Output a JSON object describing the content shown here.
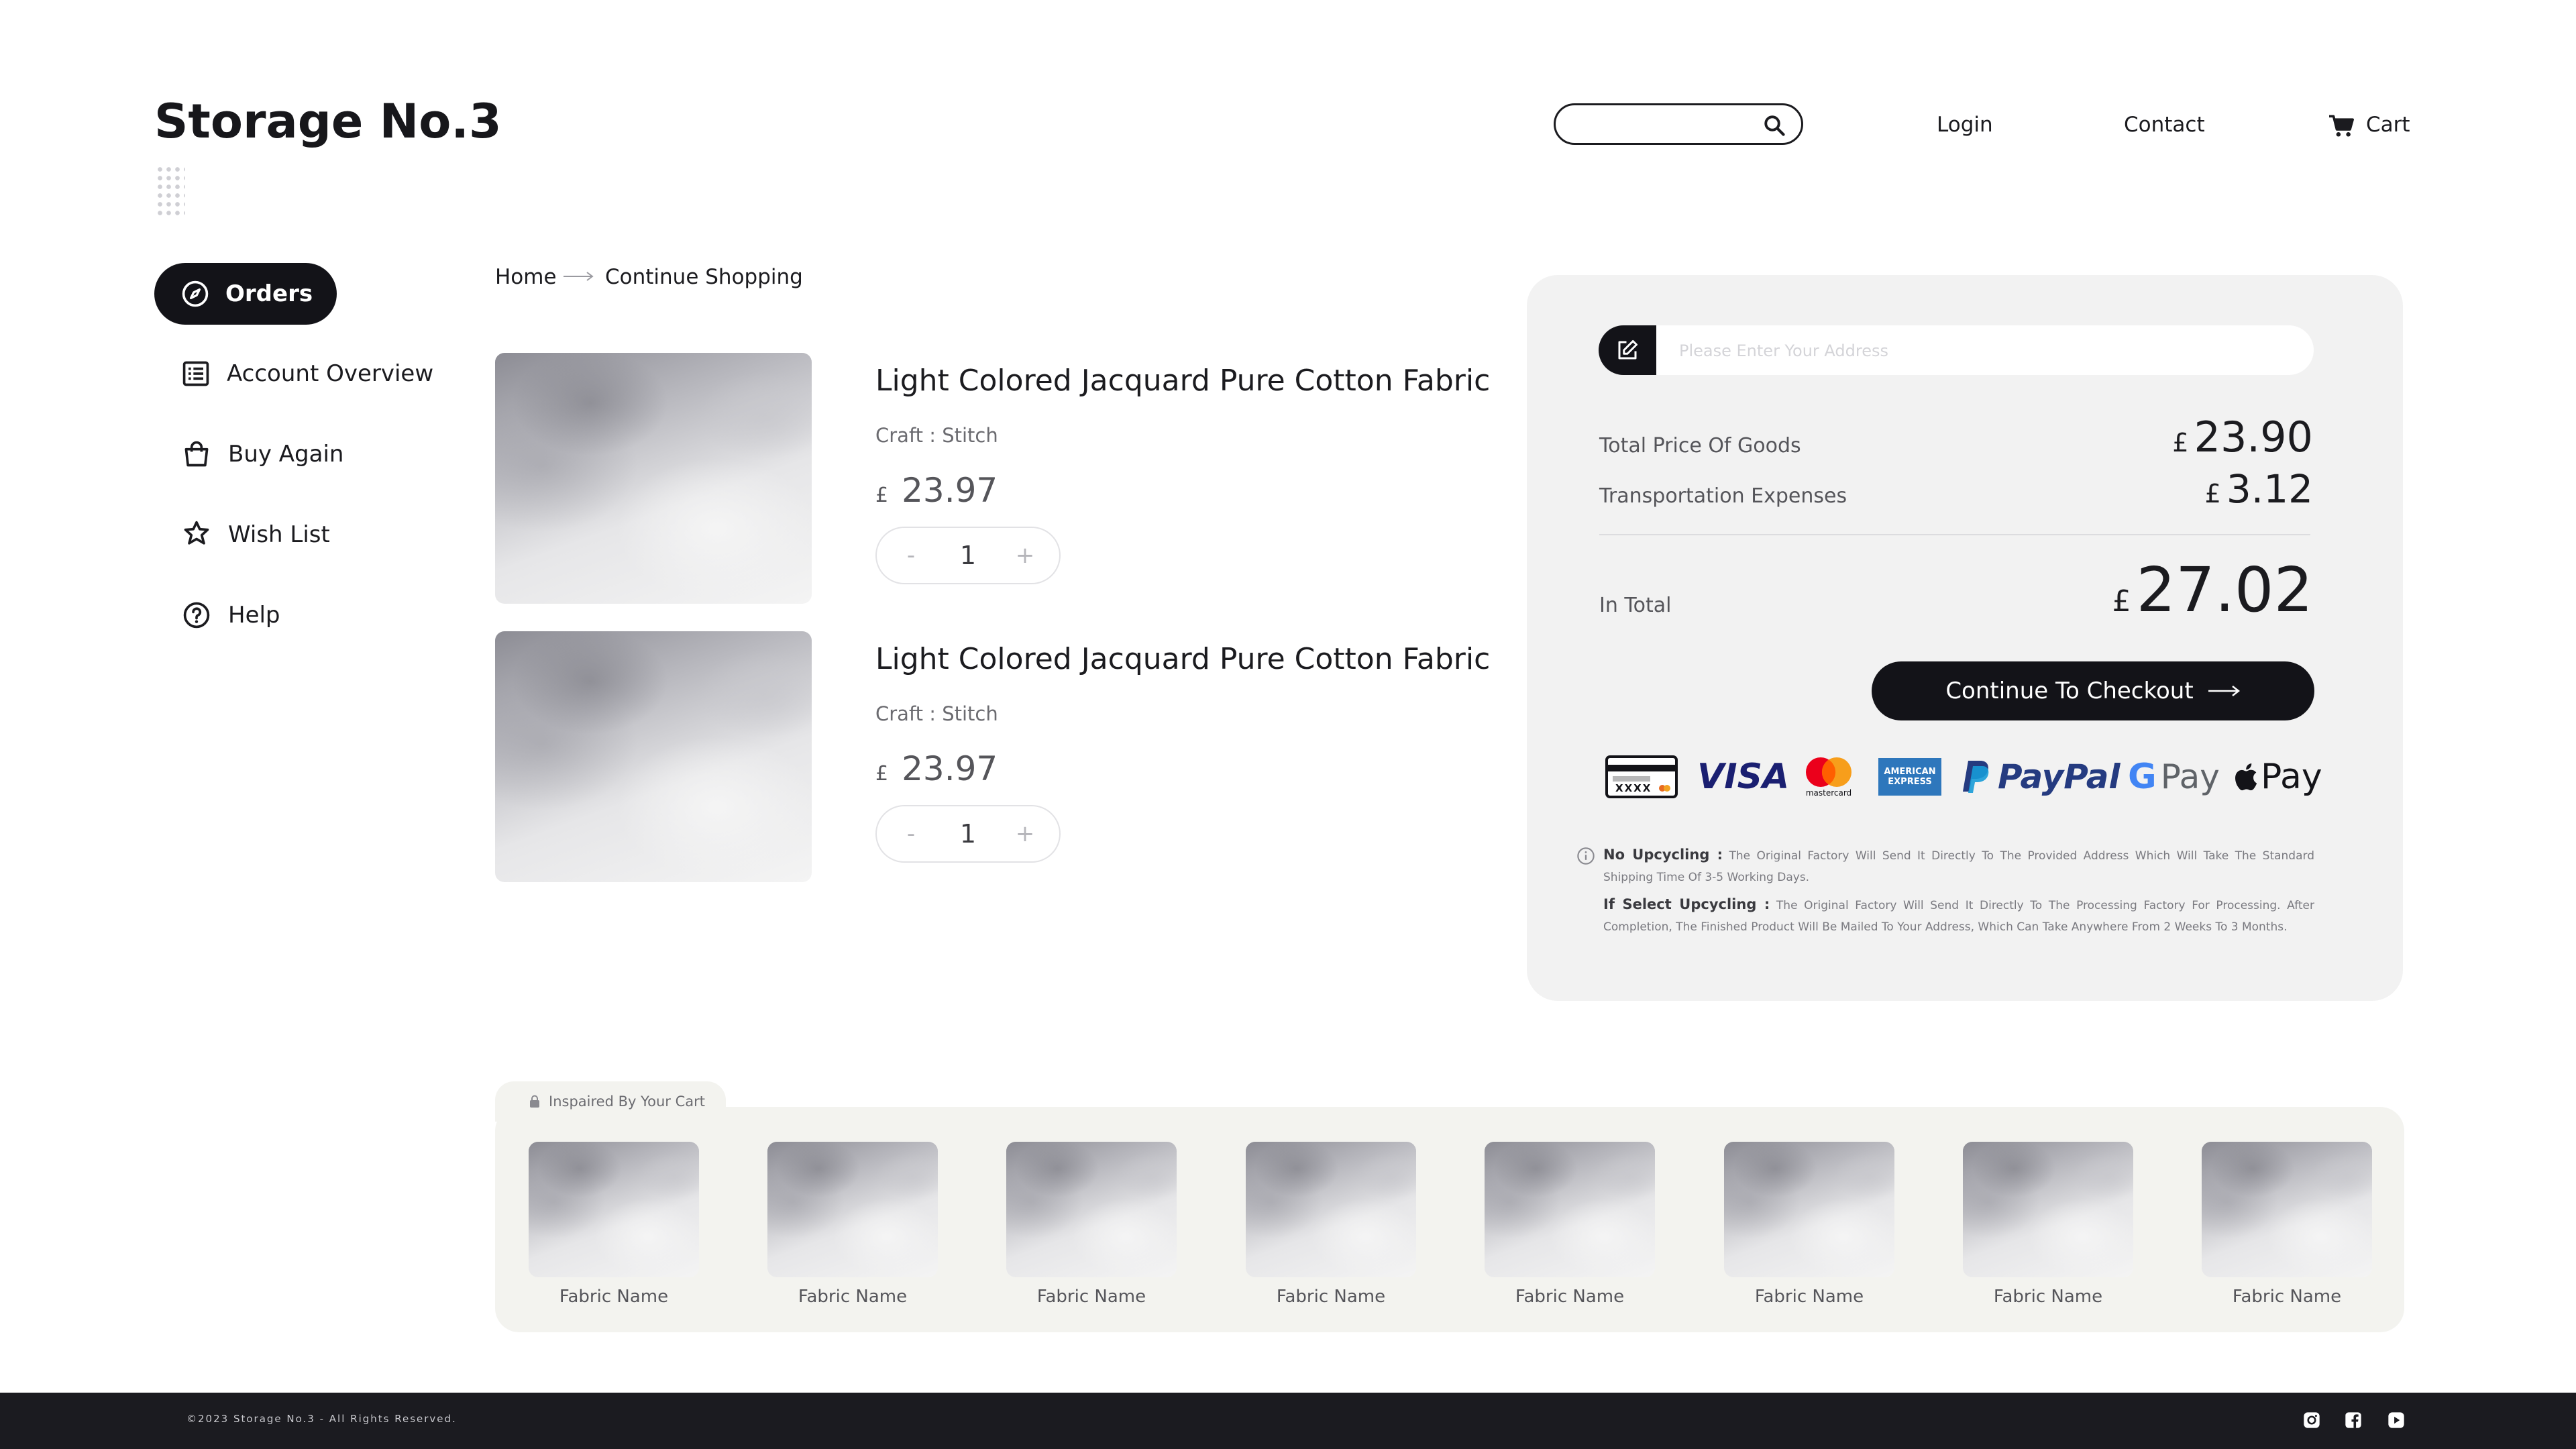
{
  "brand": {
    "logo": "Storage No.3"
  },
  "header": {
    "search_placeholder": "",
    "login": "Login",
    "contact": "Contact",
    "cart": "Cart"
  },
  "sidebar": {
    "items": [
      {
        "label": "Orders",
        "icon": "compass-icon",
        "active": true
      },
      {
        "label": "Account Overview",
        "icon": "list-icon"
      },
      {
        "label": "Buy Again",
        "icon": "shopping-bag-icon"
      },
      {
        "label": "Wish List",
        "icon": "star-icon"
      },
      {
        "label": "Help",
        "icon": "help-icon"
      }
    ]
  },
  "breadcrumb": {
    "home": "Home",
    "current": "Continue Shopping"
  },
  "cart_items": [
    {
      "title": "Light Colored Jacquard Pure Cotton Fabric",
      "craft": "Craft : Stitch",
      "currency": "£",
      "price": "23.97",
      "qty": "1",
      "minus": "-",
      "plus": "+"
    },
    {
      "title": "Light Colored Jacquard Pure Cotton Fabric",
      "craft": "Craft : Stitch",
      "currency": "£",
      "price": "23.97",
      "qty": "1",
      "minus": "-",
      "plus": "+"
    }
  ],
  "summary": {
    "address_placeholder": "Please Enter Your Address",
    "goods_label": "Total Price Of Goods",
    "goods_currency": "£",
    "goods_value": "23.90",
    "transport_label": "Transportation Expenses",
    "transport_currency": "£",
    "transport_value": "3.12",
    "total_label": "In Total",
    "total_currency": "£",
    "total_value": "27.02",
    "checkout_label": "Continue To Checkout",
    "payment_methods": {
      "card": "card-icon",
      "card_digits": "XXXX",
      "visa": "VISA",
      "mastercard": "mastercard",
      "amex": "AMERICAN EXPRESS",
      "paypal": "PayPal",
      "gpay": "Pay",
      "applepay": "Pay"
    },
    "notes": [
      {
        "title": "No Upcycling :",
        "text": "The Original Factory Will Send It Directly To The Provided Address Which Will Take The Standard Shipping Time Of 3-5 Working Days."
      },
      {
        "title": "If Select Upcycling :",
        "text": "The Original Factory Will Send It Directly To The Processing Factory For Processing. After Completion, The Finished Product Will Be Mailed To Your Address, Which Can Take Anywhere From 2 Weeks To 3 Months."
      }
    ]
  },
  "inspired": {
    "title": "Inspaired By Your Cart",
    "items": [
      {
        "name": "Fabric Name"
      },
      {
        "name": "Fabric Name"
      },
      {
        "name": "Fabric Name"
      },
      {
        "name": "Fabric Name"
      },
      {
        "name": "Fabric Name"
      },
      {
        "name": "Fabric Name"
      },
      {
        "name": "Fabric Name"
      },
      {
        "name": "Fabric Name"
      }
    ]
  },
  "footer": {
    "copyright": "©2023 Storage No.3 - All Rights Reserved.",
    "social": [
      "instagram-icon",
      "facebook-icon",
      "youtube-icon"
    ]
  },
  "colors": {
    "primary": "#131318",
    "panel_bg": "#f2f2f2",
    "inspired_bg": "#f3f3ef",
    "footer_bg": "#1b1b20",
    "visa_blue": "#1a1f71",
    "paypal_dark": "#253b80",
    "paypal_light": "#179bd7",
    "amex_blue": "#2e77bc"
  }
}
